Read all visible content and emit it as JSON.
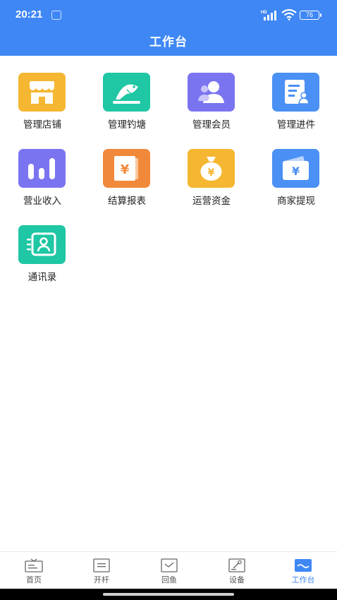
{
  "status_bar": {
    "time": "20:21",
    "network": "HD",
    "battery": "76",
    "icons": [
      "notification-icon",
      "hd-signal-icon",
      "wifi-icon",
      "battery-icon"
    ]
  },
  "header": {
    "title": "工作台",
    "background": "#3f87f5"
  },
  "grid": {
    "items": [
      {
        "label": "管理店铺",
        "icon": "store-icon",
        "color": "#f5b731"
      },
      {
        "label": "管理钓塘",
        "icon": "fish-pond-icon",
        "color": "#1fc7a4"
      },
      {
        "label": "管理会员",
        "icon": "member-icon",
        "color": "#7b74f0"
      },
      {
        "label": "管理进件",
        "icon": "document-user-icon",
        "color": "#4a90f5"
      },
      {
        "label": "营业收入",
        "icon": "bar-chart-icon",
        "color": "#7b74f0"
      },
      {
        "label": "结算报表",
        "icon": "yuan-report-icon",
        "color": "#f0893a"
      },
      {
        "label": "运营资金",
        "icon": "money-bag-icon",
        "color": "#f5b731"
      },
      {
        "label": "商家提现",
        "icon": "wallet-yuan-icon",
        "color": "#4a90f5"
      },
      {
        "label": "通讯录",
        "icon": "contacts-icon",
        "color": "#1fc7a4"
      }
    ]
  },
  "bottom_nav": {
    "items": [
      {
        "label": "首页",
        "icon": "home-tv-icon",
        "active": false
      },
      {
        "label": "开杆",
        "icon": "list-icon",
        "active": false
      },
      {
        "label": "回鱼",
        "icon": "checkbox-icon",
        "active": false
      },
      {
        "label": "设备",
        "icon": "device-tool-icon",
        "active": false
      },
      {
        "label": "工作台",
        "icon": "workbench-icon",
        "active": true
      }
    ],
    "active_color": "#3f87f5"
  }
}
